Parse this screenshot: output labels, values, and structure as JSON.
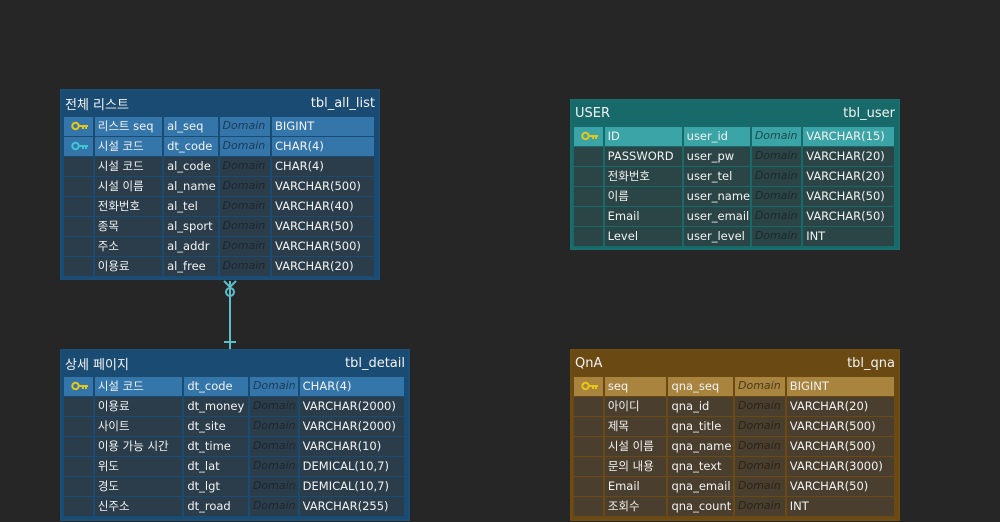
{
  "colors": {
    "fk_key": "#3ec6d6",
    "pk_key": "#e6c619",
    "connector": "#5bbfcc"
  },
  "domain_label": "Domain",
  "tables": [
    {
      "id": "all-list",
      "title": "전체 리스트",
      "name": "tbl_all_list",
      "theme": "blue",
      "rows": [
        {
          "key": "pk",
          "logical": "리스트 seq",
          "physical": "al_seq",
          "type": "BIGINT"
        },
        {
          "key": "fk",
          "logical": "시설 코드",
          "physical": "dt_code",
          "type": "CHAR(4)"
        },
        {
          "key": "",
          "logical": "시설 코드",
          "physical": "al_code",
          "type": "CHAR(4)"
        },
        {
          "key": "",
          "logical": "시설 이름",
          "physical": "al_name",
          "type": "VARCHAR(500)"
        },
        {
          "key": "",
          "logical": "전화번호",
          "physical": "al_tel",
          "type": "VARCHAR(40)"
        },
        {
          "key": "",
          "logical": "종목",
          "physical": "al_sport",
          "type": "VARCHAR(50)"
        },
        {
          "key": "",
          "logical": "주소",
          "physical": "al_addr",
          "type": "VARCHAR(500)"
        },
        {
          "key": "",
          "logical": "이용료",
          "physical": "al_free",
          "type": "VARCHAR(20)"
        }
      ]
    },
    {
      "id": "detail",
      "title": "상세 페이지",
      "name": "tbl_detail",
      "theme": "blue",
      "rows": [
        {
          "key": "pk",
          "logical": "시설 코드",
          "physical": "dt_code",
          "type": "CHAR(4)"
        },
        {
          "key": "",
          "logical": "이용료",
          "physical": "dt_money",
          "type": "VARCHAR(2000)"
        },
        {
          "key": "",
          "logical": "사이트",
          "physical": "dt_site",
          "type": "VARCHAR(2000)"
        },
        {
          "key": "",
          "logical": "이용 가능 시간",
          "physical": "dt_time",
          "type": "VARCHAR(10)"
        },
        {
          "key": "",
          "logical": "위도",
          "physical": "dt_lat",
          "type": "DEMICAL(10,7)"
        },
        {
          "key": "",
          "logical": "경도",
          "physical": "dt_lgt",
          "type": "DEMICAL(10,7)"
        },
        {
          "key": "",
          "logical": "신주소",
          "physical": "dt_road",
          "type": "VARCHAR(255)"
        }
      ]
    },
    {
      "id": "user",
      "title": "USER",
      "name": "tbl_user",
      "theme": "teal",
      "rows": [
        {
          "key": "pk",
          "logical": "ID",
          "physical": "user_id",
          "type": "VARCHAR(15)"
        },
        {
          "key": "",
          "logical": "PASSWORD",
          "physical": "user_pw",
          "type": "VARCHAR(20)"
        },
        {
          "key": "",
          "logical": "전화번호",
          "physical": "user_tel",
          "type": "VARCHAR(20)"
        },
        {
          "key": "",
          "logical": "이름",
          "physical": "user_name",
          "type": "VARCHAR(50)"
        },
        {
          "key": "",
          "logical": "Email",
          "physical": "user_email",
          "type": "VARCHAR(50)"
        },
        {
          "key": "",
          "logical": "Level",
          "physical": "user_level",
          "type": "INT"
        }
      ]
    },
    {
      "id": "qna",
      "title": "QnA",
      "name": "tbl_qna",
      "theme": "brown",
      "rows": [
        {
          "key": "pk",
          "logical": "seq",
          "physical": "qna_seq",
          "type": "BIGINT"
        },
        {
          "key": "",
          "logical": "아이디",
          "physical": "qna_id",
          "type": "VARCHAR(20)"
        },
        {
          "key": "",
          "logical": "제목",
          "physical": "qna_title",
          "type": "VARCHAR(500)"
        },
        {
          "key": "",
          "logical": "시설 이름",
          "physical": "qna_name",
          "type": "VARCHAR(500)"
        },
        {
          "key": "",
          "logical": "문의 내용",
          "physical": "qna_text",
          "type": "VARCHAR(3000)"
        },
        {
          "key": "",
          "logical": "Email",
          "physical": "qna_email",
          "type": "VARCHAR(50)"
        },
        {
          "key": "",
          "logical": "조회수",
          "physical": "qna_count",
          "type": "INT"
        }
      ]
    }
  ]
}
